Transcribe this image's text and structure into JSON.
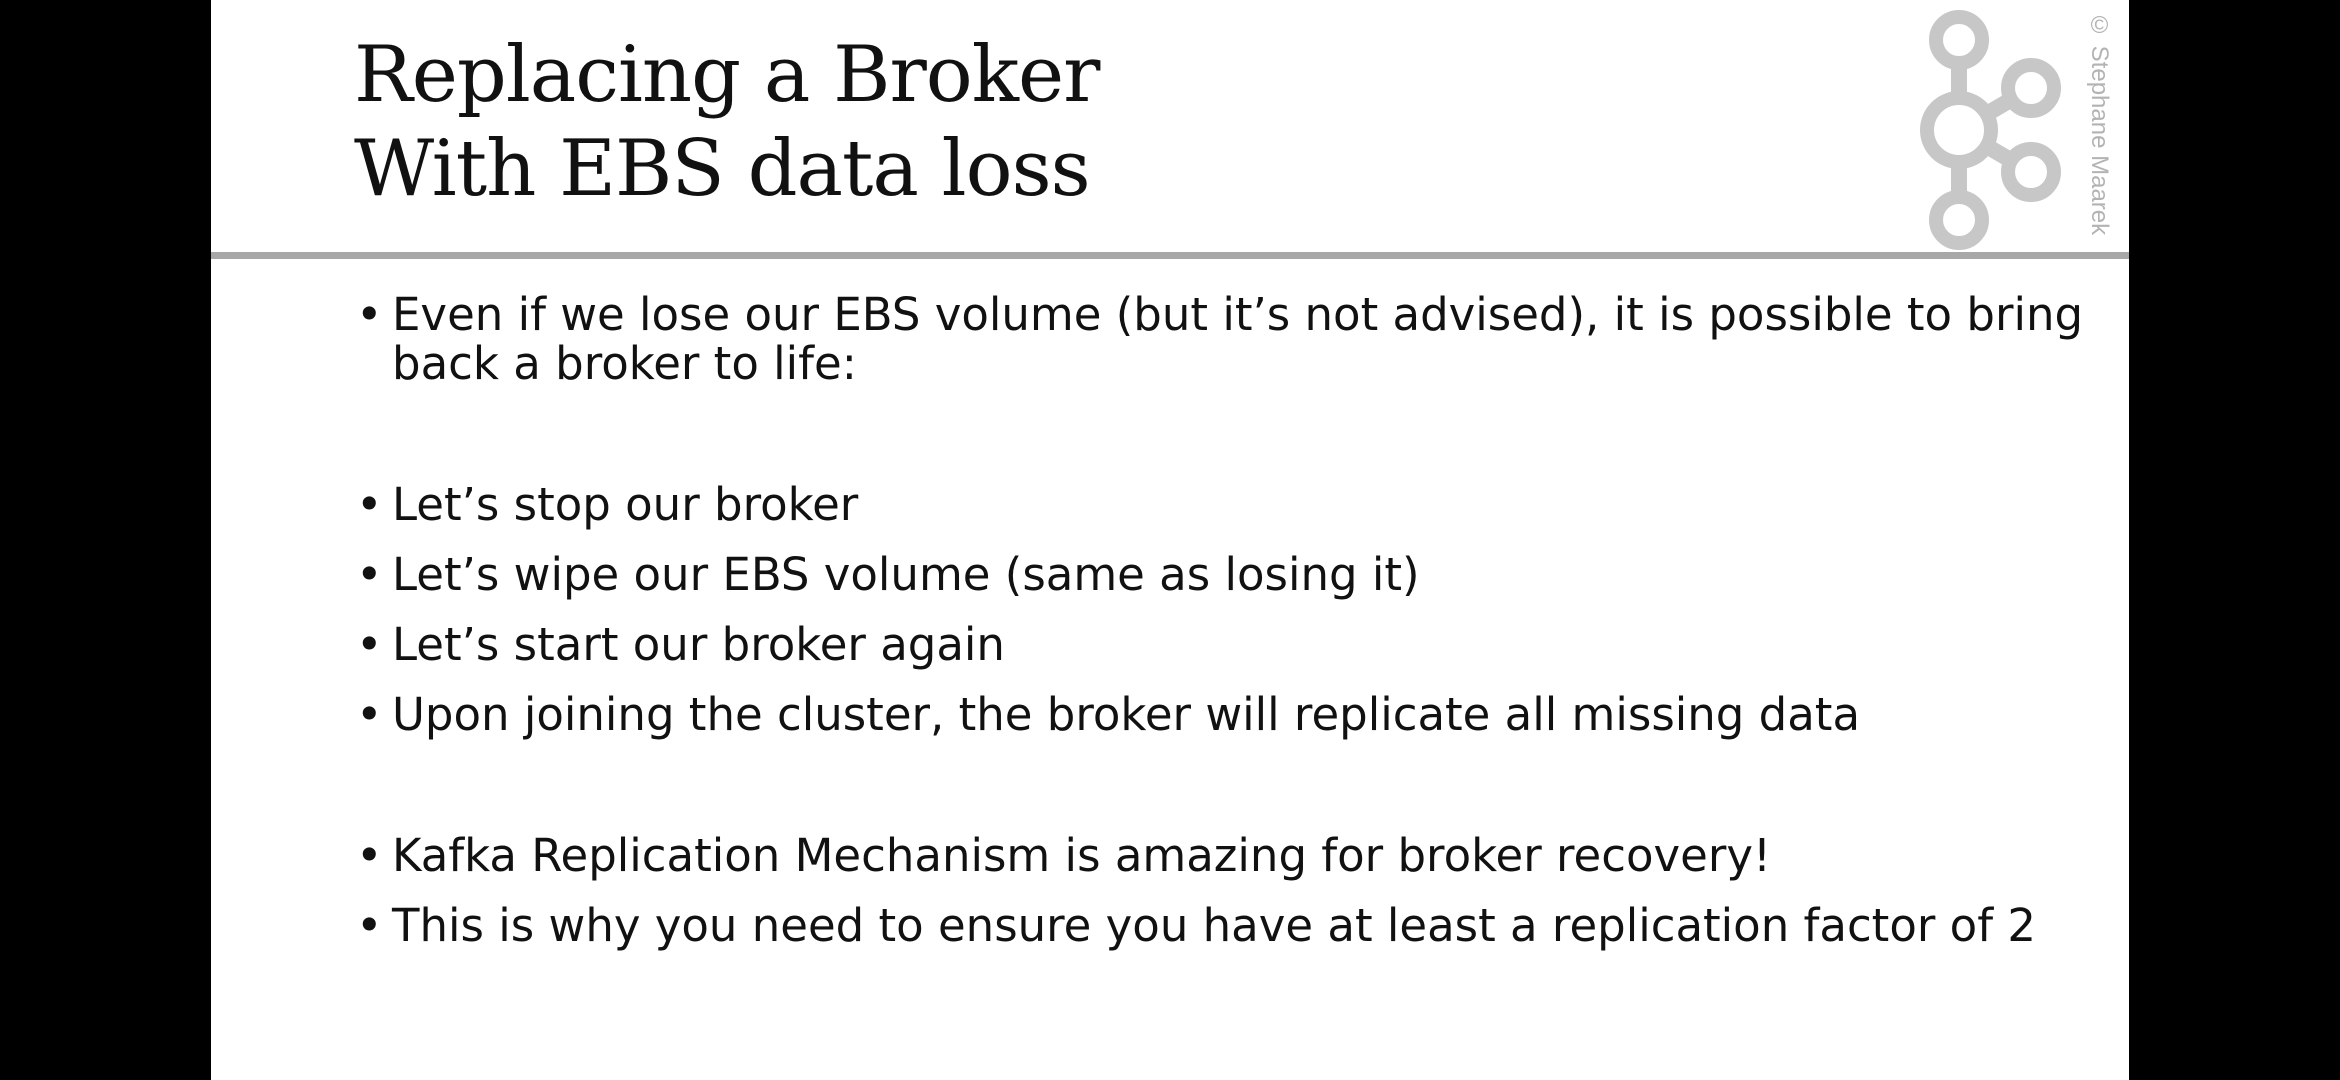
{
  "slide": {
    "title_lines": [
      "Replacing a Broker",
      "With EBS data loss"
    ],
    "copyright": "© Stephane Maarek",
    "logo_icon": "kafka-logo-icon",
    "bullets": [
      "Even if we lose our EBS volume (but it’s not advised), it is possible to bring back a broker to life:",
      "Let’s stop our broker",
      "Let’s wipe our EBS volume (same as losing it)",
      "Let’s start our broker again",
      "Upon joining the cluster, the broker will replicate all missing data",
      "Kafka Replication Mechanism is amazing for broker recovery!",
      "This is why you need to ensure you have at least a replication factor of 2"
    ]
  },
  "colors": {
    "background": "#000000",
    "slide": "#ffffff",
    "text": "#111111",
    "rule": "#a8a8a8",
    "logo": "#c7c7c7"
  }
}
